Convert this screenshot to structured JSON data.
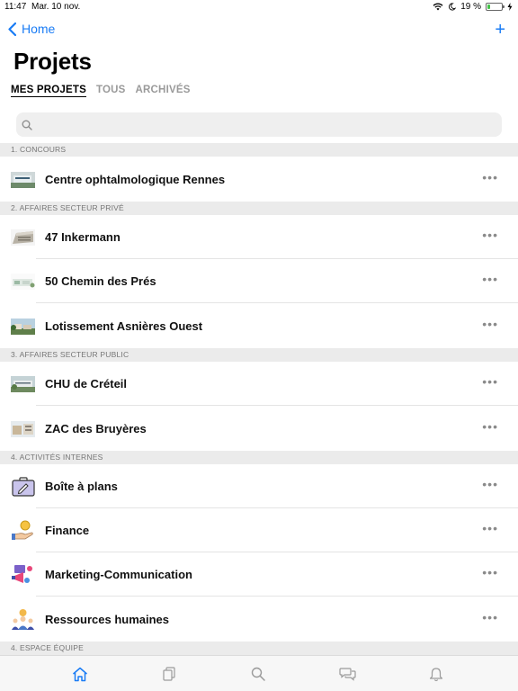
{
  "status_bar": {
    "time": "11:47",
    "date": "Mar. 10 nov.",
    "battery": "19 %",
    "battery_level": 0.19
  },
  "nav": {
    "back_label": "Home",
    "add_label": "+"
  },
  "page_title": "Projets",
  "tabs": [
    {
      "label": "MES PROJETS",
      "active": true
    },
    {
      "label": "TOUS",
      "active": false
    },
    {
      "label": "ARCHIVÉS",
      "active": false
    }
  ],
  "search": {
    "placeholder": "",
    "value": ""
  },
  "sections": [
    {
      "title": "1. CONCOURS",
      "items": [
        "Centre ophtalmologique Rennes"
      ]
    },
    {
      "title": "2. AFFAIRES SECTEUR PRIVÉ",
      "items": [
        "47 Inkermann",
        "50 Chemin des Prés",
        "Lotissement Asnières Ouest"
      ]
    },
    {
      "title": "3. AFFAIRES SECTEUR PUBLIC",
      "items": [
        "CHU de Créteil",
        "ZAC des Bruyères"
      ]
    },
    {
      "title": "4. ACTIVITÉS INTERNES",
      "items": [
        "Boîte à plans",
        "Finance",
        "Marketing-Communication",
        "Ressources humaines"
      ]
    },
    {
      "title": "4. ESPACE ÉQUIPE",
      "items": []
    }
  ],
  "more_label": "•••",
  "tabbar": [
    "home-icon",
    "documents-icon",
    "search-icon",
    "chat-icon",
    "bell-icon"
  ],
  "colors": {
    "accent": "#1a7cf5",
    "section_bg": "#ebebeb",
    "battery": "#45c34a"
  }
}
